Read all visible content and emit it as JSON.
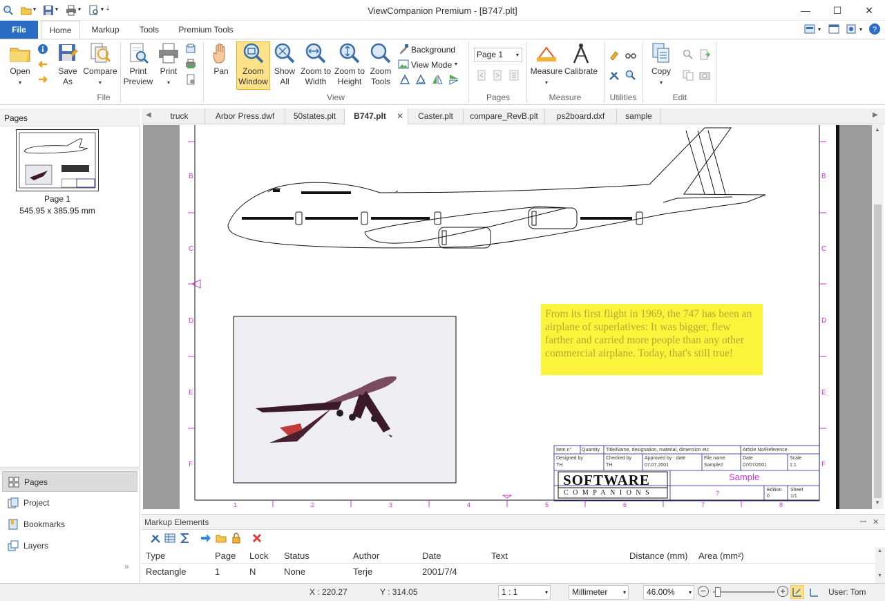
{
  "window": {
    "title": "ViewCompanion Premium - [B747.plt]"
  },
  "ribbon_tabs": [
    {
      "label": "File"
    },
    {
      "label": "Home"
    },
    {
      "label": "Markup"
    },
    {
      "label": "Tools"
    },
    {
      "label": "Premium Tools"
    }
  ],
  "ribbon": {
    "file_group": {
      "label": "File",
      "open": "Open",
      "save_as": "Save As",
      "compare": "Compare",
      "print_preview": "Print Preview",
      "print": "Print"
    },
    "view_group": {
      "label": "View",
      "pan": "Pan",
      "zoom_window": "Zoom Window",
      "show_all": "Show All",
      "zoom_width": "Zoom to Width",
      "zoom_height": "Zoom to Height",
      "zoom_tools": "Zoom Tools",
      "background": "Background",
      "view_mode": "View Mode"
    },
    "pages_group": {
      "label": "Pages",
      "page_select": "Page 1"
    },
    "measure_group": {
      "label": "Measure",
      "measure": "Measure",
      "calibrate": "Calibrate"
    },
    "utilities_group": {
      "label": "Utilities"
    },
    "edit_group": {
      "label": "Edit",
      "copy": "Copy"
    }
  },
  "left_panel": {
    "header": "Pages",
    "thumb_label": "Page 1",
    "thumb_size": "545.95 x 385.95 mm",
    "nav": [
      {
        "label": "Pages"
      },
      {
        "label": "Project"
      },
      {
        "label": "Bookmarks"
      },
      {
        "label": "Layers"
      }
    ]
  },
  "doc_tabs": [
    {
      "label": "truck"
    },
    {
      "label": "Arbor Press.dwf"
    },
    {
      "label": "50states.plt"
    },
    {
      "label": "B747.plt"
    },
    {
      "label": "Caster.plt"
    },
    {
      "label": "compare_RevB.plt"
    },
    {
      "label": "ps2board.dxf"
    },
    {
      "label": "sample"
    }
  ],
  "drawing": {
    "note": "From its first flight in 1969, the 747 has been an airplane of superlatives: It was bigger, flew farther and carried more people than any other commercial airplane. Today, that's still true!",
    "row_letters": [
      "B",
      "C",
      "D",
      "E",
      "F"
    ],
    "col_numbers": [
      "1",
      "2",
      "3",
      "4",
      "5",
      "6",
      "7",
      "8"
    ],
    "title_block": {
      "item": "Item n°",
      "quantity": "Quantity",
      "title": "Title/Name, designation, material, dimension etc",
      "article": "Article No/Reference",
      "designed_by": "Designed by",
      "designed_val": "TH",
      "checked_by": "Checked by",
      "checked_val": "TH",
      "approved": "Approved by - date",
      "approved_val": "07.07.2001",
      "file_name": "File name",
      "file_val": "Sample2",
      "date": "Date",
      "date_val": "07/07/2001",
      "scale": "Scale",
      "scale_val": "1:1",
      "logo_top": "SOFTWARE",
      "logo_bottom": "COMPANIONS",
      "sample": "Sample",
      "q": "?",
      "edition": "Edition",
      "edition_val": "0",
      "sheet": "Sheet",
      "sheet_val": "1/1"
    }
  },
  "markup": {
    "header": "Markup Elements",
    "columns": [
      "Type",
      "Page",
      "Lock",
      "Status",
      "Author",
      "Date",
      "Text",
      "Distance (mm)",
      "Area (mm²)"
    ],
    "rows": [
      {
        "type": "Rectangle",
        "page": "1",
        "lock": "N",
        "status": "None",
        "author": "Terje",
        "date": "2001/7/4"
      }
    ]
  },
  "statusbar": {
    "x": "X : 220.27",
    "y": "Y : 314.05",
    "scale": "1 : 1",
    "unit": "Millimeter",
    "zoom": "46.00%",
    "user": "User: Tom"
  },
  "colors": {
    "accent": "#2b6cc4",
    "note_bg": "#fcf43a",
    "grid_magenta": "#cc33cc",
    "title_block": "#1a1a8c"
  }
}
